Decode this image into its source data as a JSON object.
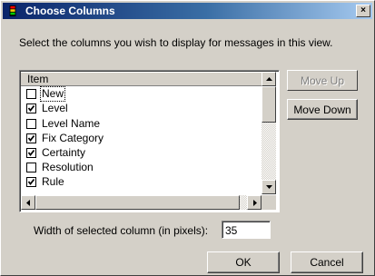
{
  "window": {
    "title": "Choose Columns",
    "close_label": "×"
  },
  "instruction": "Select the columns you wish to display for messages in this view.",
  "list": {
    "column_header": "Item",
    "items": [
      {
        "label": "New",
        "checked": false
      },
      {
        "label": "Level",
        "checked": true
      },
      {
        "label": "Level Name",
        "checked": false
      },
      {
        "label": "Fix Category",
        "checked": true
      },
      {
        "label": "Certainty",
        "checked": true
      },
      {
        "label": "Resolution",
        "checked": false
      },
      {
        "label": "Rule",
        "checked": true
      }
    ]
  },
  "buttons": {
    "move_up": "Move Up",
    "move_down": "Move Down",
    "ok": "OK",
    "cancel": "Cancel"
  },
  "width_field": {
    "label": "Width of selected column (in pixels):",
    "value": "35"
  }
}
